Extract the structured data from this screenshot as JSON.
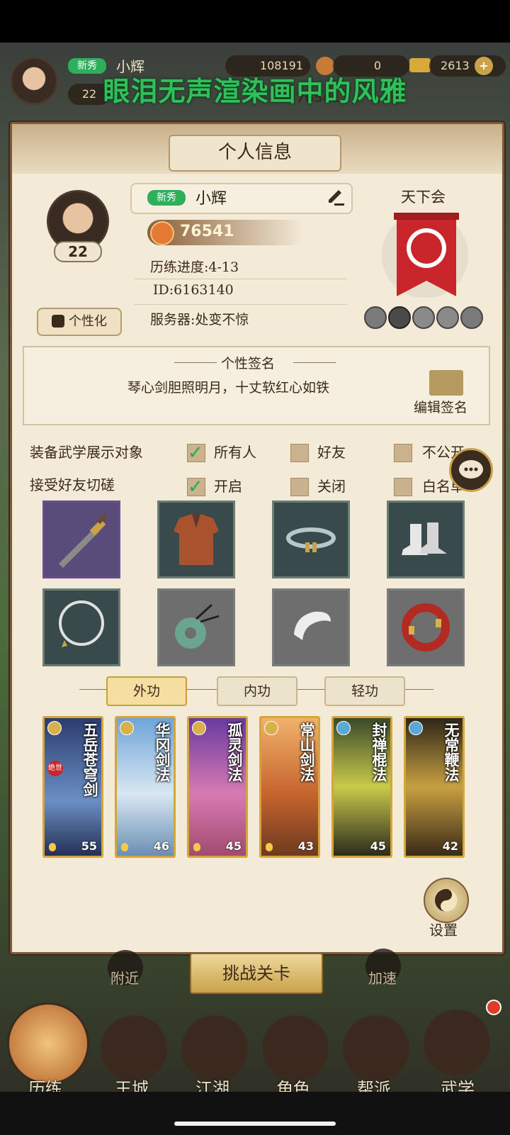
{
  "overlay": {
    "title": "眼泪无声渲染画中的风雅"
  },
  "hud": {
    "player_tag": "新秀",
    "player_name": "小辉",
    "player_level": "22",
    "coins": "108191",
    "red_currency": "0",
    "gold_currency": "2613",
    "add_symbol": "+",
    "power_partial": "76541"
  },
  "panel": {
    "title": "个人信息",
    "profile": {
      "level": "22",
      "tag": "新秀",
      "name": "小辉",
      "power": "76541",
      "progress_label": "历练进度:4-13",
      "id_label": "ID:6163140",
      "server_label": "服务器:处变不惊",
      "customize_button": "个性化"
    },
    "guild": {
      "name": "天下会"
    },
    "signature": {
      "title": "个性签名",
      "text": "琴心剑胆照明月，十丈软红心如铁",
      "edit_button": "编辑签名"
    },
    "options": {
      "display_row": {
        "label": "装备武学展示对象",
        "choices": [
          {
            "label": "所有人",
            "checked": true
          },
          {
            "label": "好友",
            "checked": false
          },
          {
            "label": "不公开",
            "checked": false
          }
        ]
      },
      "duel_row": {
        "label": "接受好友切磋",
        "choices": [
          {
            "label": "开启",
            "checked": true
          },
          {
            "label": "关闭",
            "checked": false
          },
          {
            "label": "白名单",
            "checked": false
          }
        ]
      }
    },
    "tabs": [
      "外功",
      "内功",
      "轻功"
    ],
    "active_tab": "外功",
    "skills": [
      {
        "name": "五岳苍穹剑",
        "level": "55",
        "badge": "绝世"
      },
      {
        "name": "华冈剑法",
        "level": "46"
      },
      {
        "name": "孤灵剑法",
        "level": "45"
      },
      {
        "name": "常山剑法",
        "level": "43"
      },
      {
        "name": "封禅棍法",
        "level": "45"
      },
      {
        "name": "无常鞭法",
        "level": "42"
      }
    ],
    "settings_label": "设置",
    "challenge_button": "挑战关卡",
    "nearby_label": "附近",
    "speedup_label": "加速"
  },
  "bottom_nav": [
    "历练",
    "王城",
    "江湖",
    "角色",
    "帮派",
    "武学"
  ],
  "colors": {
    "panel_bg": "#f3ead7",
    "accent_gold": "#d4a53a",
    "overlay_green": "#2fbf5b",
    "check_green": "#2aa84a",
    "guild_banner_red": "#c8262a"
  }
}
